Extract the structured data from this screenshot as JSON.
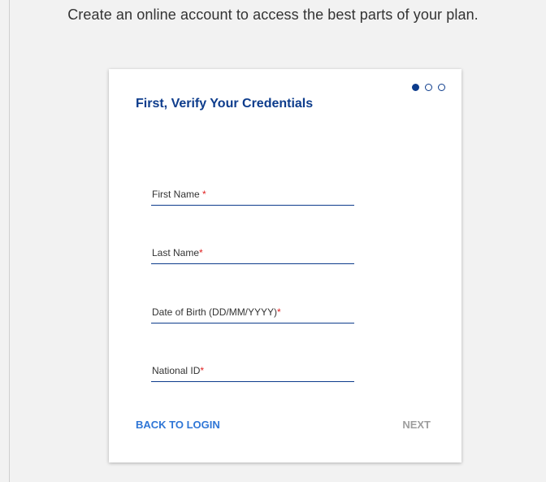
{
  "page": {
    "heading": "Create an online account to access the best parts of your plan."
  },
  "card": {
    "title": "First, Verify Your Credentials",
    "steps": {
      "current": 1,
      "total": 3
    },
    "fields": [
      {
        "label": "First Name ",
        "required_marker": "*",
        "value": ""
      },
      {
        "label": "Last Name",
        "required_marker": "*",
        "value": ""
      },
      {
        "label": "Date of Birth (DD/MM/YYYY)",
        "required_marker": "*",
        "value": ""
      },
      {
        "label": "National ID",
        "required_marker": "*",
        "value": ""
      }
    ],
    "back_label": "BACK TO LOGIN",
    "next_label": "NEXT"
  },
  "colors": {
    "brand": "#0d3c8c",
    "link": "#2f76d6",
    "required": "#e02020",
    "disabled": "#9e9e9e",
    "background": "#f2f2f2"
  }
}
